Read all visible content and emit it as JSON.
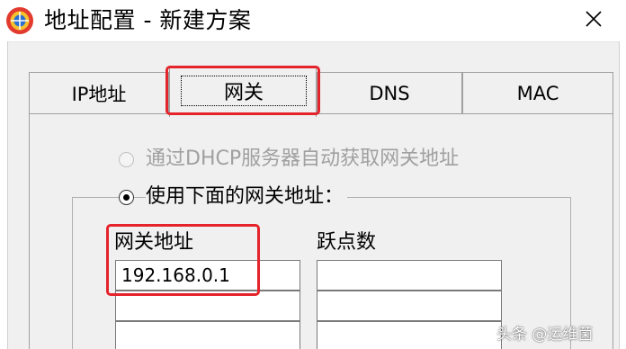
{
  "window": {
    "title": "地址配置 - 新建方案",
    "close_label": "✕"
  },
  "tabs": [
    {
      "label": "IP地址"
    },
    {
      "label": "网关"
    },
    {
      "label": "DNS"
    },
    {
      "label": "MAC"
    }
  ],
  "active_tab": "网关",
  "gateway_page": {
    "auto_option": {
      "label": "通过DHCP服务器自动获取网关地址",
      "selected": false,
      "enabled": false
    },
    "manual_option": {
      "label": "使用下面的网关地址：",
      "selected": true,
      "enabled": true
    },
    "columns": {
      "gateway": "网关地址",
      "metric": "跃点数"
    },
    "gateway_values": [
      "192.168.0.1",
      "",
      ""
    ],
    "metric_values": [
      "",
      "",
      ""
    ]
  },
  "watermark": {
    "text": "头条 @运维菌"
  },
  "colors": {
    "highlight": "#e5232b",
    "window_bg": "#f0f0f0",
    "disabled_text": "#a0a0a0"
  },
  "icons": {
    "app": "app-logo-icon",
    "close": "close-icon",
    "radio": "radio-button-icon"
  }
}
